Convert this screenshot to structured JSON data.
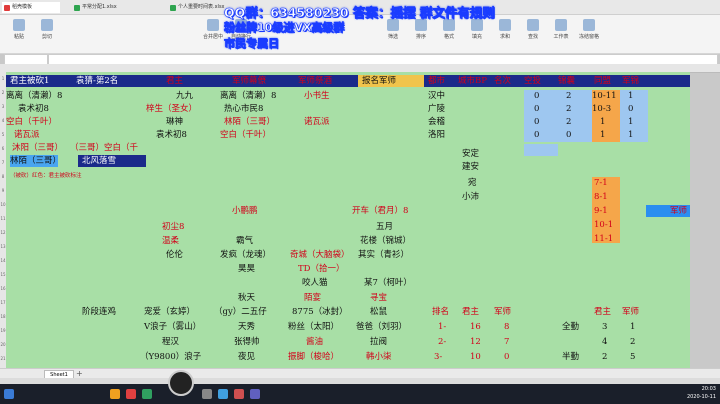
{
  "browser_tabs": [
    "稻壳模板",
    "平常分配1.xlsx",
    "个人重要时间表.xlsx"
  ],
  "toolbar_items": [
    "粘贴",
    "剪切",
    "复制",
    "格式刷",
    "合并居中",
    "自动换行",
    "筛选",
    "排序",
    "格式",
    "填充",
    "求和",
    "查找",
    "工作表",
    "冻结窗格",
    "表格样式"
  ],
  "name_box": "",
  "overlay": {
    "line1": "QQ群：634580230 答案：摇摆  群文件有规则",
    "line2": "粉丝牌10级进VX高级群",
    "line3": "市民专属日"
  },
  "header_row": {
    "a": "君主被砍1",
    "b": "袁猜-第2名",
    "c": "君主",
    "d": "军师幕僚",
    "e": "军师祭酒",
    "f": "报名军师",
    "g": "都市",
    "h": "城市BP",
    "i": "名次",
    "j": "空投",
    "k": "锦囊",
    "l": "同盟",
    "m": "军锦"
  },
  "left_block": [
    {
      "a": "离离（清濑）8",
      "c": "九九",
      "d": "离离（清濑）8",
      "e": "小书生"
    },
    {
      "a": "袁术初8",
      "c": "梓生（圣女）",
      "d": "热心市民8"
    },
    {
      "a": "空白（千叶）",
      "c": "琳神",
      "d": "林陌（三哥）",
      "e": "诺瓦派"
    },
    {
      "a": "诺瓦派",
      "c": "袁术初8",
      "d": "空白（千叶）"
    },
    {
      "a": "沐阳（三哥）",
      "b": "（三哥）空白（千"
    },
    {
      "a": "林陌（三哥）",
      "b": "北风落雪"
    }
  ],
  "cities": [
    {
      "name": "汉中",
      "kt": "0",
      "jn": "2",
      "tm": "10-11",
      "jj": "1"
    },
    {
      "name": "广陵",
      "kt": "0",
      "jn": "2",
      "tm": "10-3",
      "jj": "0"
    },
    {
      "name": "会稽",
      "kt": "0",
      "jn": "2",
      "tm": "1",
      "jj": "1"
    },
    {
      "name": "洛阳",
      "kt": "0",
      "jn": "0",
      "tm": "1",
      "jj": "1"
    }
  ],
  "extra_cities": [
    "安定",
    "建安",
    "宛",
    "小沛"
  ],
  "side_nums": [
    "7-1",
    "8-1",
    "9-1",
    "10-1",
    "11-1"
  ],
  "far_right": "军师",
  "red_note": "（被砍）红色：君主被砍标注",
  "mid_block": [
    {
      "d": "小鹏鹏",
      "f": "开车（君月）8"
    },
    {
      "c": "初尘8",
      "f": "五月"
    },
    {
      "c": "温柔",
      "d": "霸气",
      "f": "花楼（锦城）"
    },
    {
      "c": "伦伦",
      "d": "发疯（龙魂）",
      "e": "奇城（大脑袋）",
      "f": "其实（青衫）"
    },
    {
      "d": "昊昊",
      "e": "TD（拾一）"
    },
    {
      "e": "咬人猫",
      "f": "某7（柯叶）"
    },
    {
      "d": "秋天",
      "e": "陌宴",
      "f": "寻宝"
    }
  ],
  "bottom_header": {
    "b": "阶段连鸡",
    "c": "宠爱（玄婷）",
    "d": "（gy）二五仔",
    "e": "8775（冰封）",
    "f": "松鼠",
    "g": "排名",
    "h": "君主",
    "i": "军师",
    "l": "君主",
    "m": "军师"
  },
  "bottom_rows": [
    {
      "c": "V浪子（雾山）",
      "d": "天秀",
      "e": "粉丝（太阳）",
      "f": "爸爸（刘羽）",
      "g": "1-",
      "h": "16",
      "i": "8",
      "k": "全勤",
      "l": "3",
      "m": "1"
    },
    {
      "c": "程汉",
      "d": "张得帅",
      "e": "酱油",
      "f": "拉阀",
      "g": "2-",
      "h": "12",
      "i": "7",
      "l": "4",
      "m": "2"
    },
    {
      "c": "（Y9800）浪子",
      "d": "夜见",
      "e": "振脚（梭哈）",
      "f": "韩小柒",
      "g": "3-",
      "h": "10",
      "i": "0",
      "k": "半勤",
      "l": "2",
      "m": "5"
    }
  ],
  "sheet_tab": "Sheet1",
  "clock": {
    "time": "20:03",
    "date": "2020-10-11"
  },
  "colors": {
    "header_bg": "#1b2a8a",
    "cell_green": "#a8dfa6",
    "city_blue": "#9ec7f0",
    "alliance_orange": "#f5a64a",
    "overlay_text": "#ffffff",
    "overlay_stroke": "#1a3cff"
  }
}
